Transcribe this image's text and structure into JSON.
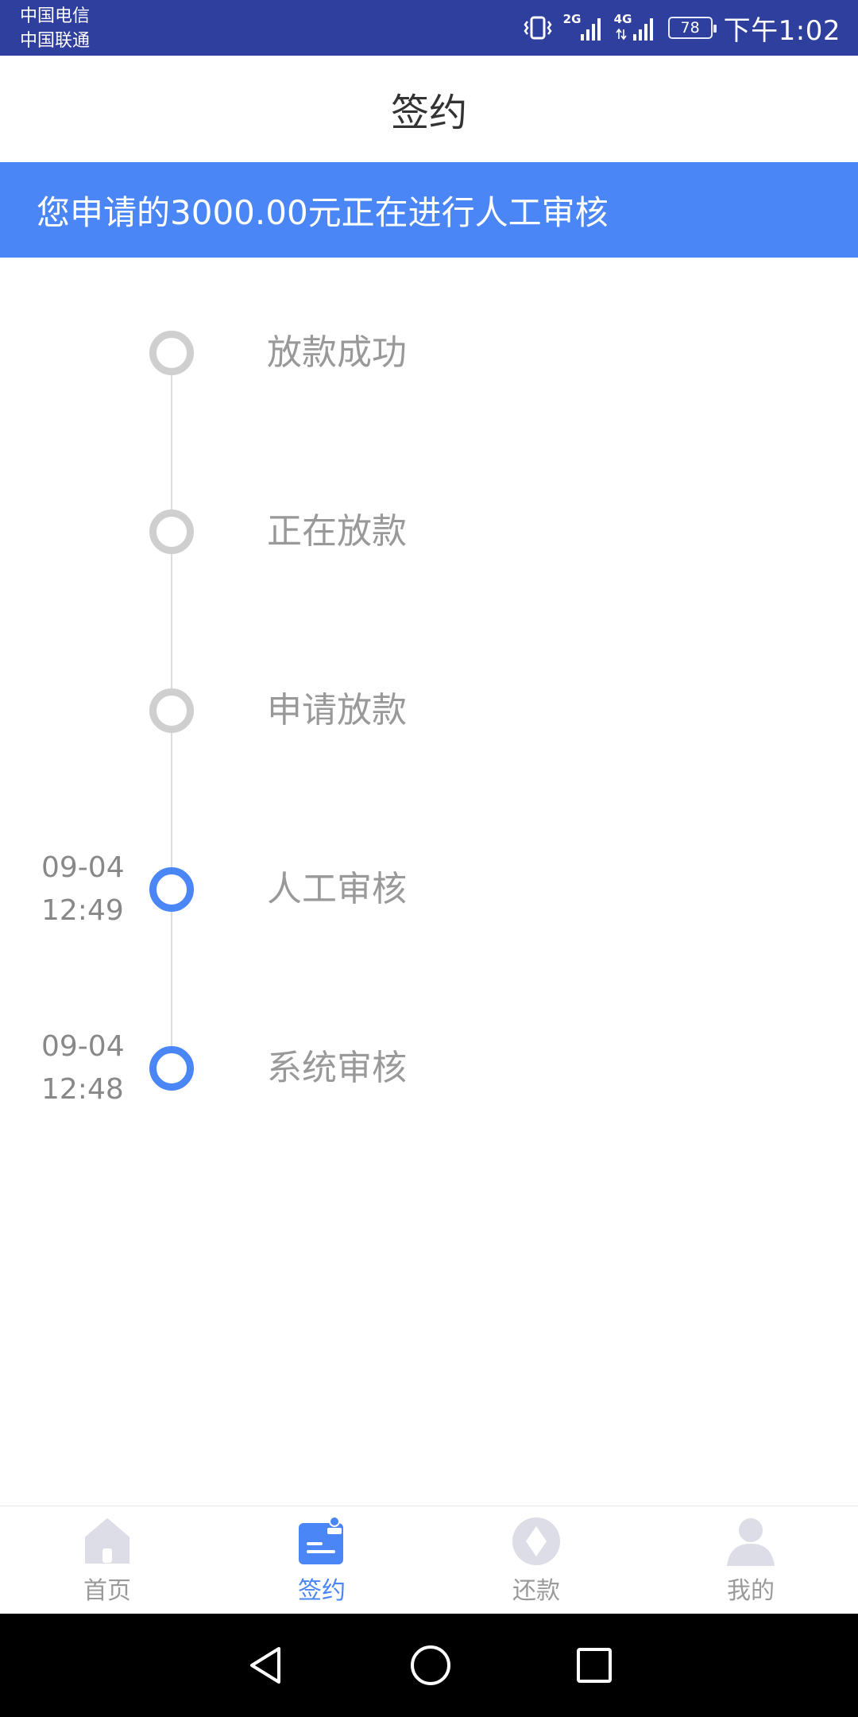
{
  "status_bar": {
    "carrier_1": "中国电信",
    "carrier_2": "中国联通",
    "network_1": "2G",
    "network_2": "4G",
    "battery": "78",
    "time": "下午1:02"
  },
  "header": {
    "title": "签约"
  },
  "banner": {
    "text": "您申请的3000.00元正在进行人工审核"
  },
  "timeline": {
    "steps": [
      {
        "label": "放款成功",
        "date": "",
        "time": "",
        "active": false
      },
      {
        "label": "正在放款",
        "date": "",
        "time": "",
        "active": false
      },
      {
        "label": "申请放款",
        "date": "",
        "time": "",
        "active": false
      },
      {
        "label": "人工审核",
        "date": "09-04",
        "time": "12:49",
        "active": true
      },
      {
        "label": "系统审核",
        "date": "09-04",
        "time": "12:48",
        "active": true
      }
    ]
  },
  "bottom_nav": {
    "items": [
      {
        "label": "首页",
        "icon": "home-icon",
        "active": false
      },
      {
        "label": "签约",
        "icon": "sign-contract-icon",
        "active": true
      },
      {
        "label": "还款",
        "icon": "repay-icon",
        "active": false
      },
      {
        "label": "我的",
        "icon": "profile-icon",
        "active": false
      }
    ]
  },
  "system_nav": {
    "icons": [
      "back-icon",
      "home-circle-icon",
      "recents-icon"
    ]
  },
  "colors": {
    "status_bar_bg": "#2f3f9e",
    "accent": "#4a86f5",
    "inactive_dot": "#cfcfcf",
    "inactive_text": "#999999"
  }
}
